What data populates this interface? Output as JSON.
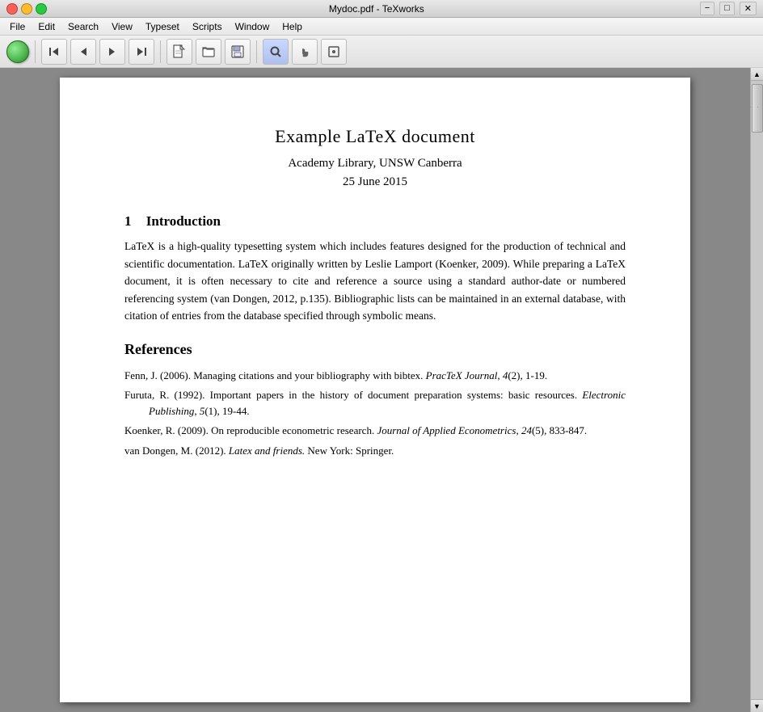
{
  "titlebar": {
    "title": "Mydoc.pdf - TeXworks",
    "close_label": "×",
    "min_label": "−",
    "max_label": "□"
  },
  "menubar": {
    "items": [
      "File",
      "Edit",
      "Search",
      "View",
      "Typeset",
      "Scripts",
      "Window",
      "Help"
    ]
  },
  "toolbar": {
    "buttons": [
      {
        "name": "green-go",
        "icon": "●",
        "tooltip": "Typeset"
      },
      {
        "name": "first-page",
        "icon": "⏮",
        "tooltip": "First page"
      },
      {
        "name": "prev-page",
        "icon": "◀",
        "tooltip": "Previous page"
      },
      {
        "name": "next-page",
        "icon": "▶",
        "tooltip": "Next page"
      },
      {
        "name": "last-page",
        "icon": "⏭",
        "tooltip": "Last page"
      },
      {
        "name": "new-doc",
        "icon": "📄",
        "tooltip": "New document"
      },
      {
        "name": "open-doc",
        "icon": "📂",
        "tooltip": "Open document"
      },
      {
        "name": "save-doc",
        "icon": "💾",
        "tooltip": "Save document"
      },
      {
        "name": "find",
        "icon": "🔍",
        "tooltip": "Find"
      },
      {
        "name": "hand",
        "icon": "✋",
        "tooltip": "Scroll"
      },
      {
        "name": "sync",
        "icon": "🔄",
        "tooltip": "Sync"
      }
    ]
  },
  "document": {
    "title": "Example LaTeX document",
    "author": "Academy Library, UNSW Canberra",
    "date": "25 June 2015",
    "sections": [
      {
        "number": "1",
        "heading": "Introduction",
        "body": "LaTeX is a high-quality typesetting system which includes features designed for the production of technical and scientific documentation. LaTeX originally written by Leslie Lamport (Koenker, 2009). While preparing a LaTeX document, it is often necessary to cite and reference a source using a standard author-date or numbered referencing system (van Dongen, 2012, p.135). Bibliographic lists can be maintained in an external database, with citation of entries from the database specified through symbolic means."
      }
    ],
    "references": {
      "heading": "References",
      "entries": [
        {
          "text": "Fenn, J. (2006). Managing citations and your bibliography with bibtex.",
          "italic_part": "PracTeX Journal",
          "rest": ", 4(2), 1-19."
        },
        {
          "text": "Furuta, R. (1992). Important papers in the history of document preparation systems: basic resources.",
          "italic_part": "Electronic Publishing",
          "rest": ", 5(1), 19-44."
        },
        {
          "text": "Koenker, R. (2009). On reproducible econometric research.",
          "italic_part": "Journal of Applied Econometrics",
          "rest": ", 24(5), 833-847."
        },
        {
          "text": "van Dongen, M. (2012).",
          "italic_part": "Latex and friends.",
          "rest": " New York: Springer."
        }
      ]
    }
  }
}
